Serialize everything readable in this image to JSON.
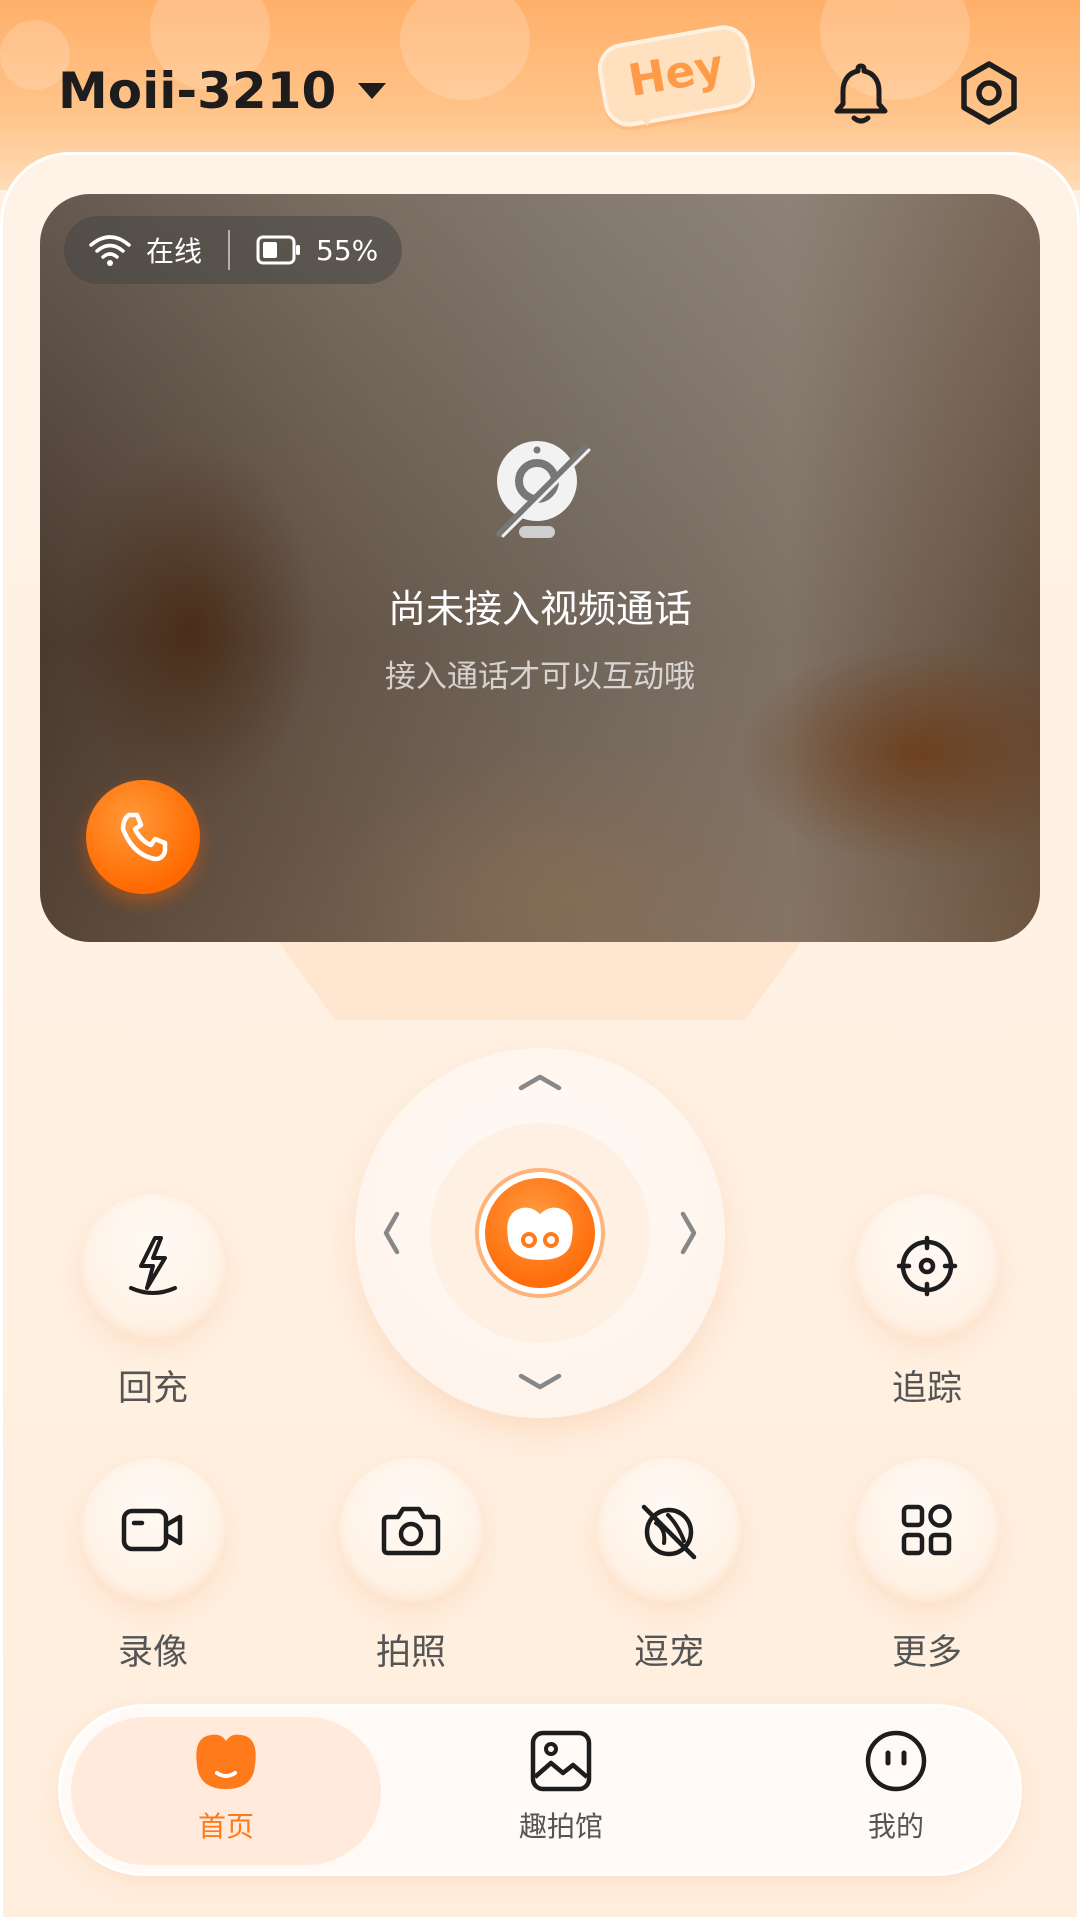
{
  "header": {
    "device_name": "Moii-3210",
    "badge_text": "Hey",
    "icons": [
      "chevron-down-icon",
      "bell-icon",
      "settings-icon"
    ]
  },
  "video": {
    "status": {
      "connection": "在线",
      "battery": "55%"
    },
    "message_title": "尚未接入视频通话",
    "message_sub": "接入通话才可以互动哦",
    "icons": [
      "wifi-icon",
      "battery-icon",
      "camera-off-icon",
      "phone-icon"
    ]
  },
  "controls": {
    "recharge": "回充",
    "track": "追踪",
    "record": "录像",
    "photo": "拍照",
    "play_pet": "逗宠",
    "more": "更多"
  },
  "nav": {
    "home": "首页",
    "gallery": "趣拍馆",
    "mine": "我的"
  },
  "colors": {
    "accent": "#ff7a1a",
    "header_bg": "#ffb06a",
    "page_bg": "#fff1e4"
  }
}
